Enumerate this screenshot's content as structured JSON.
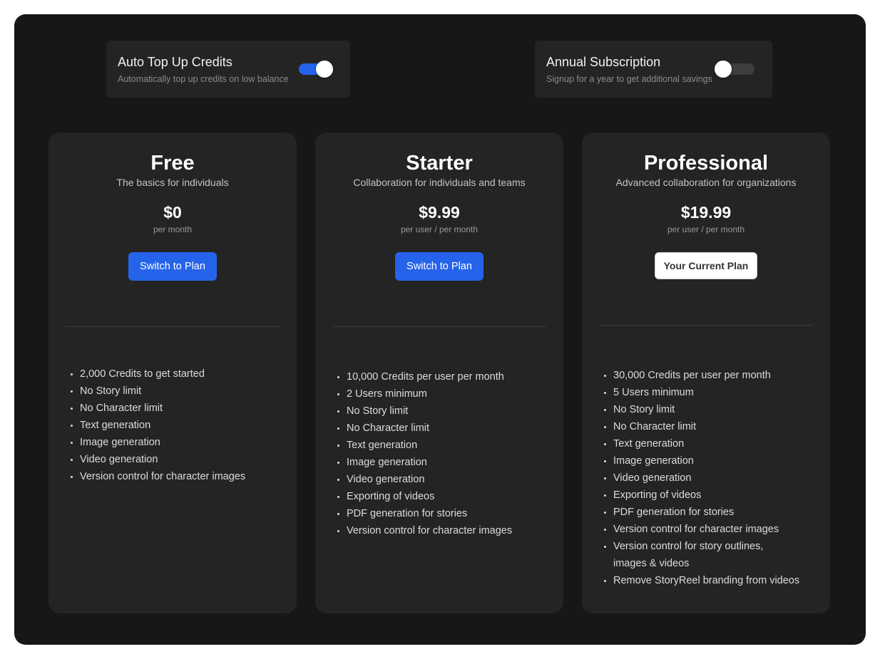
{
  "toggles": {
    "auto_top_up": {
      "title": "Auto Top Up Credits",
      "description": "Automatically top up credits on low balance",
      "enabled": true
    },
    "annual": {
      "title": "Annual Subscription",
      "description": "Signup for a year to get additional savings",
      "enabled": false
    }
  },
  "plans": [
    {
      "name": "Free",
      "tagline": "The basics for individuals",
      "price": "$0",
      "period": "per month",
      "button_label": "Switch to Plan",
      "features": [
        "2,000 Credits to get started",
        "No Story limit",
        "No Character limit",
        "Text generation",
        "Image generation",
        "Video generation",
        "Version control for character images"
      ]
    },
    {
      "name": "Starter",
      "tagline": "Collaboration for individuals and teams",
      "price": "$9.99",
      "period": "per user / per month",
      "button_label": "Switch to Plan",
      "features": [
        "10,000 Credits per user per month",
        "2 Users minimum",
        "No Story limit",
        "No Character limit",
        "Text generation",
        "Image generation",
        "Video generation",
        "Exporting of videos",
        "PDF generation for stories",
        "Version control for character images"
      ]
    },
    {
      "name": "Professional",
      "tagline": "Advanced collaboration for organizations",
      "price": "$19.99",
      "period": "per user / per month",
      "button_label": "Your Current Plan",
      "features": [
        "30,000 Credits per user per month",
        "5 Users minimum",
        "No Story limit",
        "No Character limit",
        "Text generation",
        "Image generation",
        "Video generation",
        "Exporting of videos",
        "PDF generation for stories",
        "Version control for character images",
        "Version control for story outlines, images & videos",
        "Remove StoryReel branding from videos"
      ]
    }
  ],
  "colors": {
    "panel_bg": "#171717",
    "card_bg": "#242424",
    "accent": "#2563eb"
  }
}
